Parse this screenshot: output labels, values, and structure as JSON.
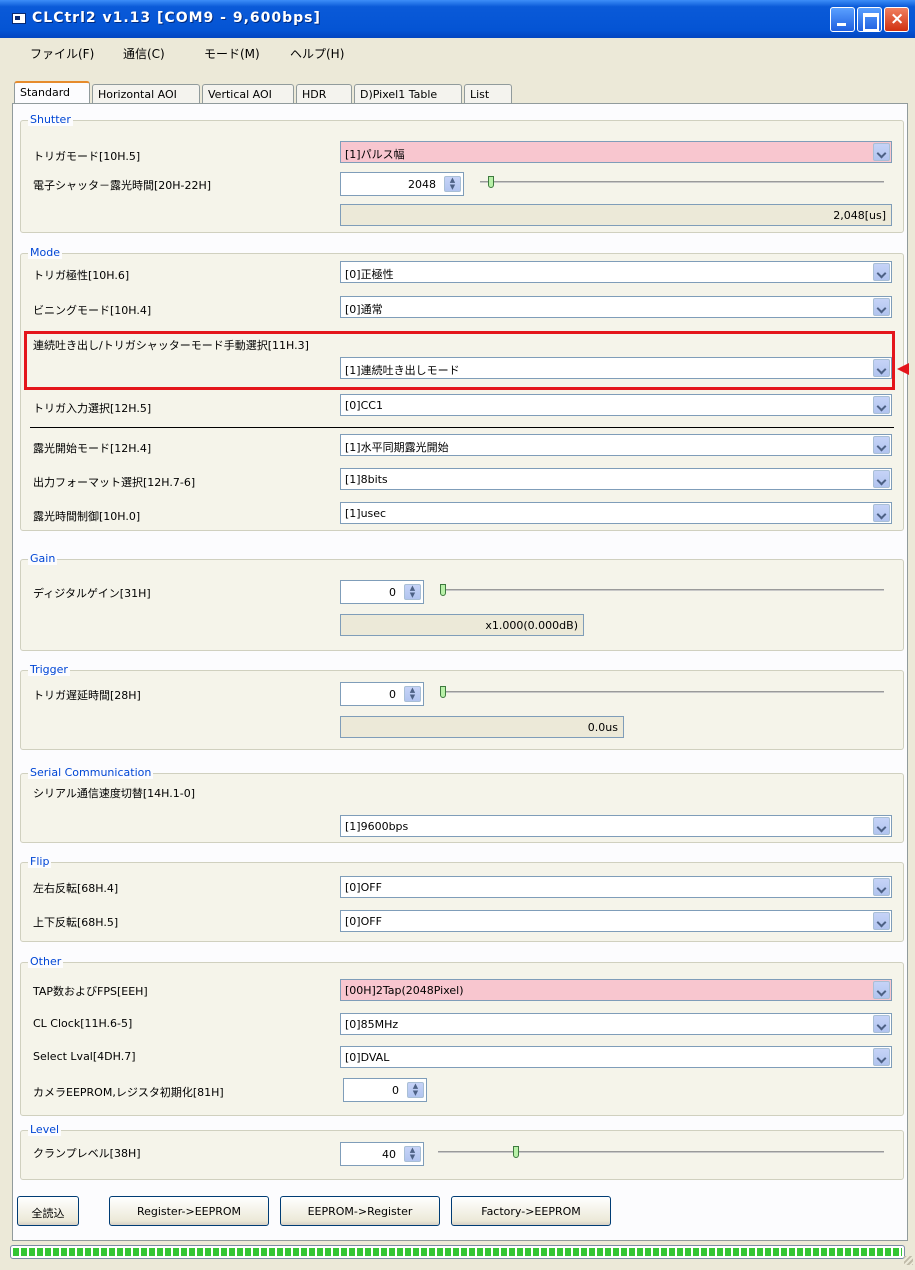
{
  "window": {
    "title": "CLCtrl2 v1.13  [COM9 - 9,600bps]"
  },
  "menu": [
    "ファイル(F)",
    "通信(C)",
    "モード(M)",
    "ヘルプ(H)"
  ],
  "tabs": [
    "Standard",
    "Horizontal AOI",
    "Vertical AOI",
    "HDR",
    "D)Pixel1 Table",
    "List"
  ],
  "shutter": {
    "title": "Shutter",
    "trigger_mode_label": "トリガモード[10H.5]",
    "trigger_mode_value": "[1]パルス幅",
    "exposure_label": "電子シャッタ－露光時間[20H-22H]",
    "exposure_value": "2048",
    "exposure_readout": "2,048[us]",
    "exposure_slider_fraction": 0.02
  },
  "mode": {
    "title": "Mode",
    "polarity_label": "トリガ極性[10H.6]",
    "polarity_value": "[0]正極性",
    "binning_label": "ビニングモード[10H.4]",
    "binning_value": "[0]通常",
    "continuous_label": "連続吐き出し/トリガシャッターモード手動選択[11H.3]",
    "continuous_value": "[1]連続吐き出しモード",
    "trigger_input_label": "トリガ入力選択[12H.5]",
    "trigger_input_value": "[0]CC1",
    "exposure_start_label": "露光開始モード[12H.4]",
    "exposure_start_value": "[1]水平同期露光開始",
    "output_format_label": "出力フォーマット選択[12H.7-6]",
    "output_format_value": "[1]8bits",
    "exposure_control_label": "露光時間制御[10H.0]",
    "exposure_control_value": "[1]usec"
  },
  "gain": {
    "title": "Gain",
    "digital_gain_label": "ディジタルゲイン[31H]",
    "digital_gain_value": "0",
    "digital_gain_readout": "x1.000(0.000dB)",
    "slider_fraction": 0.0
  },
  "trigger": {
    "title": "Trigger",
    "delay_label": "トリガ遅延時間[28H]",
    "delay_value": "0",
    "delay_readout": "0.0us",
    "slider_fraction": 0.0
  },
  "serial": {
    "title": "Serial Communication",
    "speed_label": "シリアル通信速度切替[14H.1-0]",
    "speed_value": "[1]9600bps"
  },
  "flip": {
    "title": "Flip",
    "lr_label": "左右反転[68H.4]",
    "lr_value": "[0]OFF",
    "ud_label": "上下反転[68H.5]",
    "ud_value": "[0]OFF"
  },
  "other": {
    "title": "Other",
    "tap_label": "TAP数およびFPS[EEH]",
    "tap_value": "[00H]2Tap(2048Pixel)",
    "clock_label": "CL Clock[11H.6-5]",
    "clock_value": "[0]85MHz",
    "lval_label": "Select Lval[4DH.7]",
    "lval_value": "[0]DVAL",
    "init_label": "カメラEEPROM,レジスタ初期化[81H]",
    "init_value": "0"
  },
  "level": {
    "title": "Level",
    "clamp_label": "クランプレベル[38H]",
    "clamp_value": "40",
    "slider_fraction": 0.17
  },
  "buttons": {
    "read_all": "全読込",
    "reg_to_eeprom": "Register->EEPROM",
    "eeprom_to_reg": "EEPROM->Register",
    "factory": "Factory->EEPROM"
  },
  "progress_fraction": 1.0,
  "colors": {
    "highlight": "#e4151b",
    "pink_field": "#f8c6cf",
    "group_title": "#0046d5"
  }
}
